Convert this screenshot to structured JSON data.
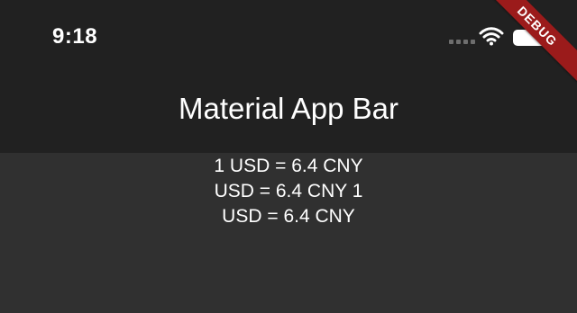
{
  "status_bar": {
    "time": "9:18"
  },
  "app_bar": {
    "title": "Material App Bar"
  },
  "content": {
    "lines": [
      "1 USD = 6.4 CNY",
      "USD = 6.4 CNY 1",
      "USD = 6.4 CNY"
    ]
  },
  "debug_banner": {
    "label": "DEBUG"
  },
  "icons": {
    "signal": "signal-dots-icon",
    "wifi": "wifi-icon",
    "battery": "battery-icon"
  },
  "colors": {
    "app_bar_background": "#212121",
    "body_background": "#303030",
    "debug_banner": "#9b1b1b",
    "text": "#ffffff"
  }
}
